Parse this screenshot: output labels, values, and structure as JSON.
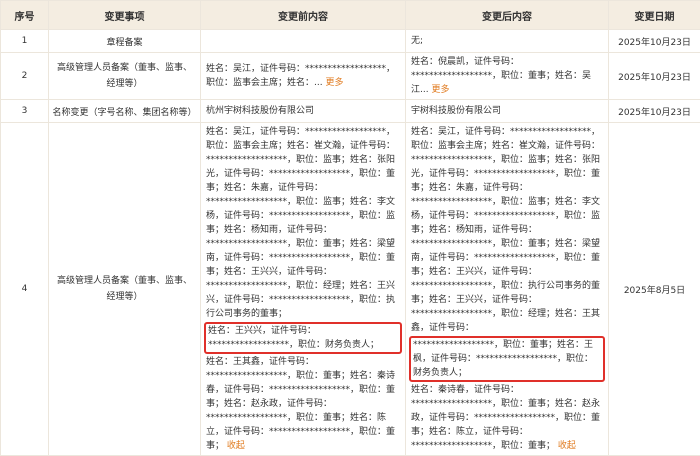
{
  "headers": [
    "序号",
    "变更事项",
    "变更前内容",
    "变更后内容",
    "变更日期"
  ],
  "rows": [
    {
      "index": "1",
      "item": "章程备案",
      "before": "",
      "after": "无;",
      "date": "2025年10月23日"
    },
    {
      "index": "2",
      "item": "高级管理人员备案（董事、监事、经理等）",
      "before": "姓名：吴江，证件号码：******************，职位：监事会主席；姓名：...",
      "before_more": "更多",
      "after": "姓名：倪晨凯，证件号码：******************，职位：董事；姓名：吴江...",
      "after_more": "更多",
      "date": "2025年10月23日"
    },
    {
      "index": "3",
      "item": "名称变更（字号名称、集团名称等）",
      "before": "杭州宇树科技股份有限公司",
      "after": "宇树科技股份有限公司",
      "date": "2025年10月23日"
    },
    {
      "index": "4",
      "item": "高级管理人员备案（董事、监事、经理等）",
      "before_pre": "姓名：吴江，证件号码：******************，职位：监事会主席；姓名：崔文瀚，证件号码：******************，职位：监事；姓名：张阳光，证件号码：******************，职位：董事；姓名：朱嘉，证件号码：******************，职位：监事；姓名：李文杨，证件号码：******************，职位：监事；姓名：杨知雨，证件号码：******************，职位：董事；姓名：梁望南，证件号码：******************，职位：董事；姓名：王兴兴，证件号码：******************，职位：经理；姓名：王兴兴，证件号码：******************，职位：执行公司事务的董事；",
      "before_hl": "姓名：王兴兴，证件号码：******************，职位：财务负责人；",
      "before_post": "姓名：王其鑫，证件号码：******************，职位：董事；姓名：秦诗春，证件号码：******************，职位：董事；姓名：赵永政，证件号码：******************，职位：董事；姓名：陈立，证件号码：******************，职位：董事；",
      "before_fold": "收起",
      "after_pre": "姓名：吴江，证件号码：******************，职位：监事会主席；姓名：崔文瀚，证件号码：******************，职位：监事；姓名：张阳光，证件号码：******************，职位：董事；姓名：朱嘉，证件号码：******************，职位：监事；姓名：李文杨，证件号码：******************，职位：监事；姓名：杨知雨，证件号码：******************，职位：董事；姓名：梁望南，证件号码：******************，职位：董事；姓名：王兴兴，证件号码：******************，职位：执行公司事务的董事；姓名：王兴兴，证件号码：******************，职位：经理；姓名：王其鑫，证件号码：",
      "after_hl": "******************，职位：董事；姓名：王枫，证件号码：******************，职位：财务负责人；",
      "after_post": "姓名：秦诗春，证件号码：******************，职位：董事；姓名：赵永政，证件号码：******************，职位：董事；姓名：陈立，证件号码：******************，职位：董事；",
      "after_fold": "收起",
      "date": "2025年8月5日"
    }
  ],
  "colors": {
    "header_bg": "#f4ede1",
    "border": "#ece6dc",
    "link": "#e07a1e",
    "highlight": "#e0302a"
  }
}
